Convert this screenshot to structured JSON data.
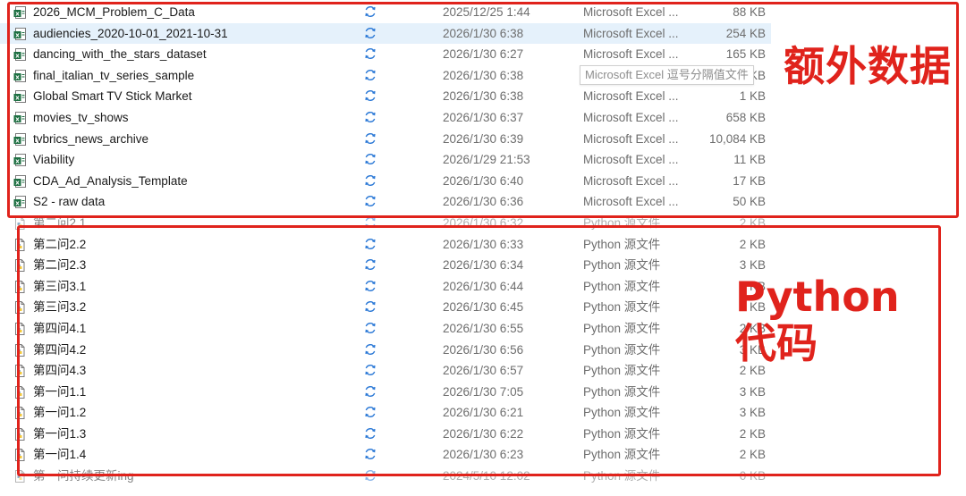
{
  "excel_files": [
    {
      "name": "2026_MCM_Problem_C_Data",
      "date": "2025/12/25 1:44",
      "type": "Microsoft Excel ...",
      "size": "88 KB"
    },
    {
      "name": "audiencies_2020-10-01_2021-10-31",
      "date": "2026/1/30 6:38",
      "type": "Microsoft Excel ...",
      "size": "254 KB"
    },
    {
      "name": "dancing_with_the_stars_dataset",
      "date": "2026/1/30 6:27",
      "type": "Microsoft Excel ...",
      "size": "165 KB"
    },
    {
      "name": "final_italian_tv_series_sample",
      "date": "2026/1/30 6:38",
      "type": "Microsoft Excel ...",
      "size": "11 KB"
    },
    {
      "name": "Global Smart TV Stick Market",
      "date": "2026/1/30 6:38",
      "type": "Microsoft Excel ...",
      "size": "1 KB"
    },
    {
      "name": "movies_tv_shows",
      "date": "2026/1/30 6:37",
      "type": "Microsoft Excel ...",
      "size": "658 KB"
    },
    {
      "name": "tvbrics_news_archive",
      "date": "2026/1/30 6:39",
      "type": "Microsoft Excel ...",
      "size": "10,084 KB"
    },
    {
      "name": "Viability",
      "date": "2026/1/29 21:53",
      "type": "Microsoft Excel ...",
      "size": "11 KB"
    },
    {
      "name": "CDA_Ad_Analysis_Template",
      "date": "2026/1/30 6:40",
      "type": "Microsoft Excel ...",
      "size": "17 KB"
    },
    {
      "name": "S2 - raw data",
      "date": "2026/1/30 6:36",
      "type": "Microsoft Excel ...",
      "size": "50 KB"
    }
  ],
  "python_files": [
    {
      "name": "第二问2.1",
      "date": "2026/1/30 6:32",
      "type": "Python 源文件",
      "size": "2 KB"
    },
    {
      "name": "第二问2.2",
      "date": "2026/1/30 6:33",
      "type": "Python 源文件",
      "size": "2 KB"
    },
    {
      "name": "第二问2.3",
      "date": "2026/1/30 6:34",
      "type": "Python 源文件",
      "size": "3 KB"
    },
    {
      "name": "第三问3.1",
      "date": "2026/1/30 6:44",
      "type": "Python 源文件",
      "size": "3 KB"
    },
    {
      "name": "第三问3.2",
      "date": "2026/1/30 6:45",
      "type": "Python 源文件",
      "size": "3 KB"
    },
    {
      "name": "第四问4.1",
      "date": "2026/1/30 6:55",
      "type": "Python 源文件",
      "size": "2 KB"
    },
    {
      "name": "第四问4.2",
      "date": "2026/1/30 6:56",
      "type": "Python 源文件",
      "size": "3 KB"
    },
    {
      "name": "第四问4.3",
      "date": "2026/1/30 6:57",
      "type": "Python 源文件",
      "size": "2 KB"
    },
    {
      "name": "第一问1.1",
      "date": "2026/1/30 7:05",
      "type": "Python 源文件",
      "size": "3 KB"
    },
    {
      "name": "第一问1.2",
      "date": "2026/1/30 6:21",
      "type": "Python 源文件",
      "size": "3 KB"
    },
    {
      "name": "第一问1.3",
      "date": "2026/1/30 6:22",
      "type": "Python 源文件",
      "size": "2 KB"
    },
    {
      "name": "第一问1.4",
      "date": "2026/1/30 6:23",
      "type": "Python 源文件",
      "size": "2 KB"
    },
    {
      "name": "第一问持续更新ing",
      "date": "2024/5/10 12:02",
      "type": "Python 源文件",
      "size": "0 KB"
    }
  ],
  "annotations": {
    "excel_label": "额外数据",
    "python_label": "Python代码"
  },
  "tooltip": {
    "text": "Microsoft Excel 逗号分隔值文件"
  },
  "colors": {
    "annotation_red": "#e0231c",
    "selection_bg": "#e5f1fb",
    "sync_blue": "#2a78d6",
    "excel_green": "#1d6f42"
  },
  "icons": {
    "excel_row": "excel-csv-file-icon",
    "python_row": "python-file-icon",
    "sync": "sync-status-icon"
  }
}
